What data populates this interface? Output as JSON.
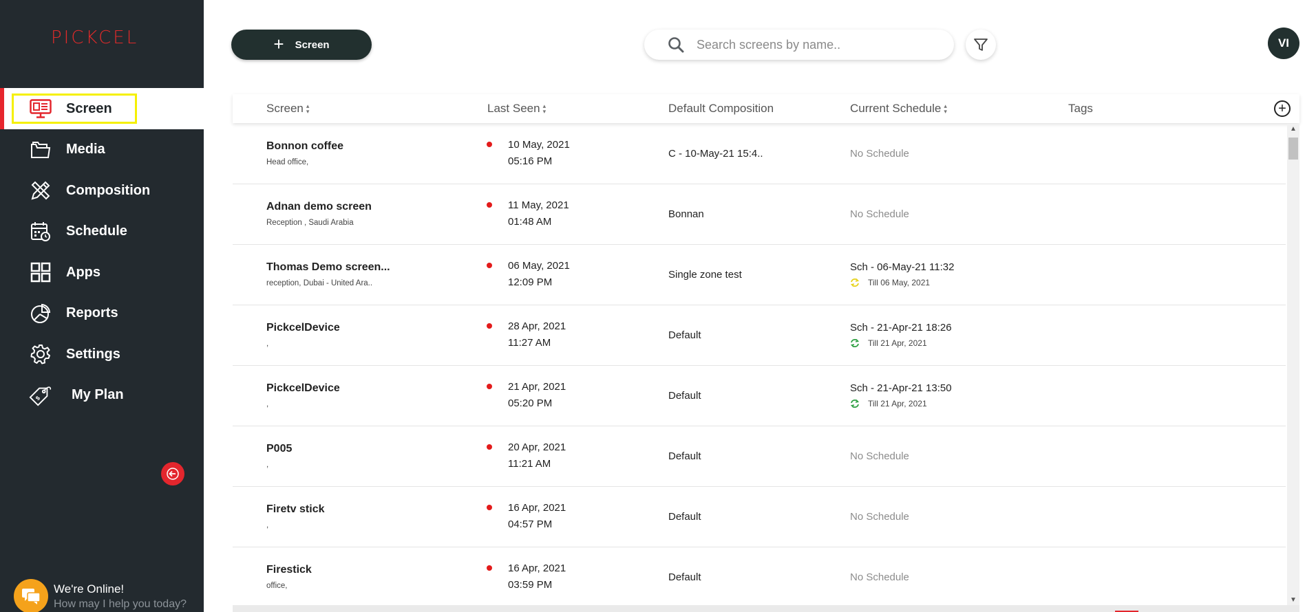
{
  "app": {
    "logo": "PICKCEL"
  },
  "sidebar": {
    "items": [
      {
        "label": "Screen",
        "icon": "monitor-icon",
        "active": true
      },
      {
        "label": "Media",
        "icon": "folder-icon"
      },
      {
        "label": "Composition",
        "icon": "design-tools-icon"
      },
      {
        "label": "Schedule",
        "icon": "calendar-clock-icon"
      },
      {
        "label": "Apps",
        "icon": "grid-apps-icon"
      },
      {
        "label": "Reports",
        "icon": "pie-chart-icon"
      },
      {
        "label": "Settings",
        "icon": "gear-icon"
      },
      {
        "label": "My Plan",
        "icon": "price-tag-icon"
      }
    ],
    "chat": {
      "title": "We're Online!",
      "subtitle": "How may I help you today?"
    }
  },
  "toolbar": {
    "add_label": "Screen",
    "search_placeholder": "Search screens by name..",
    "avatar_initials": "VI"
  },
  "table": {
    "headers": {
      "screen": "Screen",
      "last_seen": "Last Seen",
      "default_composition": "Default Composition",
      "current_schedule": "Current Schedule",
      "tags": "Tags"
    },
    "rows": [
      {
        "name": "Bonnon coffee",
        "location": "Head office,",
        "date": "10 May, 2021",
        "time": "05:16 PM",
        "composition": "C - 10-May-21 15:4..",
        "schedule": "No Schedule",
        "till": ""
      },
      {
        "name": "Adnan demo screen",
        "location": "Reception , Saudi Arabia",
        "date": "11 May, 2021",
        "time": "01:48 AM",
        "composition": "Bonnan",
        "schedule": "No Schedule",
        "till": ""
      },
      {
        "name": "Thomas Demo screen...",
        "location": "reception, Dubai - United Ara..",
        "date": "06 May, 2021",
        "time": "12:09 PM",
        "composition": "Single zone test",
        "schedule": "Sch - 06-May-21 11:32",
        "till": "Till 06 May, 2021",
        "till_color": "#e6d21a"
      },
      {
        "name": "PickcelDevice",
        "location": ",",
        "date": "28 Apr, 2021",
        "time": "11:27 AM",
        "composition": "Default",
        "schedule": "Sch - 21-Apr-21 18:26",
        "till": "Till 21 Apr, 2021",
        "till_color": "#2ea043"
      },
      {
        "name": "PickcelDevice",
        "location": ",",
        "date": "21 Apr, 2021",
        "time": "05:20 PM",
        "composition": "Default",
        "schedule": "Sch - 21-Apr-21 13:50",
        "till": "Till 21 Apr, 2021",
        "till_color": "#2ea043"
      },
      {
        "name": "P005",
        "location": ",",
        "date": "20 Apr, 2021",
        "time": "11:21 AM",
        "composition": "Default",
        "schedule": "No Schedule",
        "till": ""
      },
      {
        "name": "Firetv stick",
        "location": ",",
        "date": "16 Apr, 2021",
        "time": "04:57 PM",
        "composition": "Default",
        "schedule": "No Schedule",
        "till": ""
      },
      {
        "name": "Firestick",
        "location": "office,",
        "date": "16 Apr, 2021",
        "time": "03:59 PM",
        "composition": "Default",
        "schedule": "No Schedule",
        "till": ""
      }
    ]
  },
  "colors": {
    "sidebar_bg": "#232a2f",
    "accent_red": "#e3262d",
    "highlight_yellow": "#f5f000",
    "button_dark": "#22302f"
  }
}
